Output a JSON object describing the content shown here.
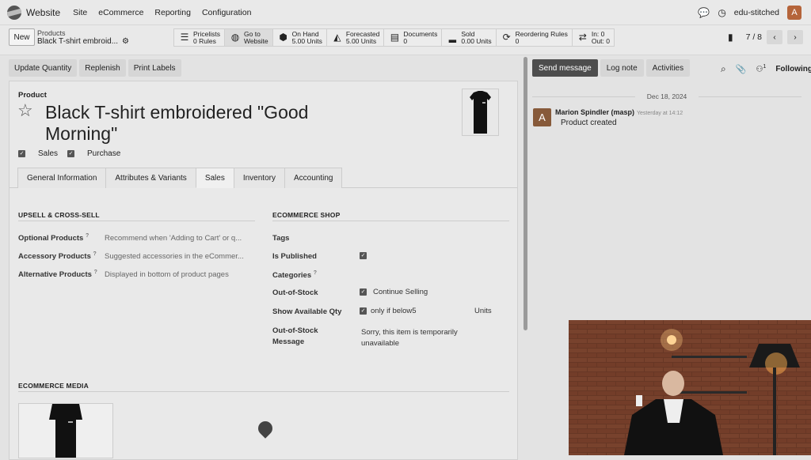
{
  "topbar": {
    "app_name": "Website",
    "nav": [
      "Site",
      "eCommerce",
      "Reporting",
      "Configuration"
    ],
    "company": "edu-stitched",
    "avatar_initial": "A"
  },
  "control": {
    "new_label": "New",
    "breadcrumb_parent": "Products",
    "breadcrumb_current": "Black T-shirt embroid...",
    "pager": "7 / 8",
    "smart_buttons": [
      {
        "icon": "list-icon",
        "glyph": "☰",
        "line1": "Pricelists",
        "line2": "0 Rules"
      },
      {
        "icon": "globe-icon",
        "glyph": "◍",
        "line1": "Go to",
        "line2": "Website"
      },
      {
        "icon": "cubes-icon",
        "glyph": "⬢",
        "line1": "On Hand",
        "line2": "5.00 Units"
      },
      {
        "icon": "area-chart-icon",
        "glyph": "◭",
        "line1": "Forecasted",
        "line2": "5.00 Units"
      },
      {
        "icon": "document-icon",
        "glyph": "▤",
        "line1": "Documents",
        "line2": "0"
      },
      {
        "icon": "signal-icon",
        "glyph": "▂",
        "line1": "Sold",
        "line2": "0.00 Units"
      },
      {
        "icon": "refresh-icon",
        "glyph": "⟳",
        "line1": "Reordering Rules",
        "line2": "0"
      },
      {
        "icon": "exchange-icon",
        "glyph": "⇄",
        "line1": "In: 0",
        "line2": "Out: 0"
      }
    ]
  },
  "actions": [
    "Update Quantity",
    "Replenish",
    "Print Labels"
  ],
  "product": {
    "label": "Product",
    "title": "Black T-shirt embroidered \"Good Morning\"",
    "sales_label": "Sales",
    "purchase_label": "Purchase"
  },
  "tabs": [
    "General Information",
    "Attributes & Variants",
    "Sales",
    "Inventory",
    "Accounting"
  ],
  "upsell": {
    "title": "UPSELL & CROSS-SELL",
    "optional_label": "Optional Products",
    "optional_placeholder": "Recommend when 'Adding to Cart' or q...",
    "accessory_label": "Accessory Products",
    "accessory_placeholder": "Suggested accessories in the eCommer...",
    "alternative_label": "Alternative Products",
    "alternative_placeholder": "Displayed in bottom of product pages"
  },
  "shop": {
    "title": "ECOMMERCE SHOP",
    "tags_label": "Tags",
    "published_label": "Is Published",
    "categories_label": "Categories",
    "oos_label": "Out-of-Stock",
    "oos_value": "Continue Selling",
    "show_qty_label": "Show Available Qty",
    "show_qty_value": "only if below",
    "show_qty_number": "5",
    "show_qty_unit": "Units",
    "oos_msg_label_1": "Out-of-Stock",
    "oos_msg_label_2": "Message",
    "oos_msg_value_1": "Sorry, this item is temporarily",
    "oos_msg_value_2": "unavailable"
  },
  "media": {
    "title": "ECOMMERCE MEDIA"
  },
  "chatter": {
    "send_message": "Send message",
    "log_note": "Log note",
    "activities": "Activities",
    "attachments_count": "1",
    "following": "Following",
    "date": "Dec 18, 2024",
    "author": "Marion Spindler (masp)",
    "time": "Yesterday at 14:12",
    "body": "Product created",
    "author_initial": "A"
  }
}
